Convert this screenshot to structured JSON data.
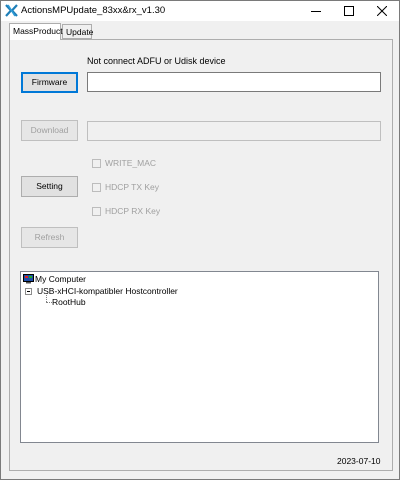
{
  "window": {
    "title": "ActionsMPUpdate_83xx&rx_v1.30"
  },
  "tabs": [
    {
      "label": "MassProduct",
      "active": true
    },
    {
      "label": "Update",
      "active": false
    }
  ],
  "status_message": "Not connect ADFU or Udisk device",
  "buttons": {
    "firmware": "Firmware",
    "download": "Download",
    "setting": "Setting",
    "refresh": "Refresh"
  },
  "fields": {
    "firmware_path": "",
    "download_path": ""
  },
  "checkboxes": [
    {
      "label": "WRITE_MAC",
      "checked": false,
      "enabled": false
    },
    {
      "label": "HDCP TX Key",
      "checked": false,
      "enabled": false
    },
    {
      "label": "HDCP RX Key",
      "checked": false,
      "enabled": false
    }
  ],
  "tree": {
    "root": "My Computer",
    "controller": "USB-xHCI-kompatibler Hostcontroller",
    "hub": "RootHub"
  },
  "footer": {
    "date": "2023-07-10"
  },
  "colors": {
    "focus_border": "#0078d7",
    "disabled_text": "#a0a0a0",
    "titlebar_bg": "#ffffff",
    "window_bg": "#f0f0f0"
  },
  "icons": {
    "app": "actions-x-icon",
    "minimize": "minimize-icon",
    "maximize": "maximize-icon",
    "close": "close-icon",
    "computer": "computer-icon"
  }
}
